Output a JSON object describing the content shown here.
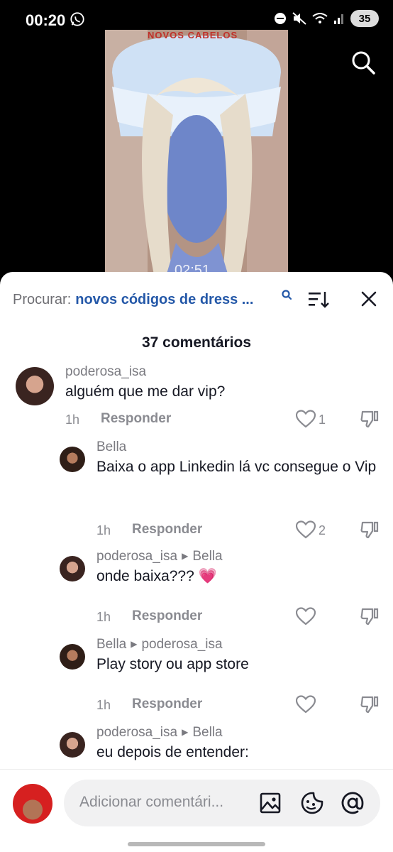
{
  "status": {
    "time": "00:20",
    "battery": "35"
  },
  "video": {
    "banner": "NOVOS CABELOS",
    "timestamp": "02:51"
  },
  "search": {
    "prefix": "Procurar:",
    "query": "novos códigos de dress ..."
  },
  "comments_count": "37 comentários",
  "comments": [
    {
      "user": "poderosa_isa",
      "text": "alguém que me dar vip?",
      "age": "1h",
      "reply": "Responder",
      "likes": "1"
    },
    {
      "user": "Bella",
      "text": "Baixa o app Linkedin lá vc consegue o Vip",
      "age": "1h",
      "reply": "Responder",
      "likes": "2"
    },
    {
      "user": "poderosa_isa",
      "reply_to": "Bella",
      "text": "onde baixa??? 💗",
      "age": "1h",
      "reply": "Responder",
      "likes": ""
    },
    {
      "user": "Bella",
      "reply_to": "poderosa_isa",
      "text": "Play story ou app store",
      "age": "1h",
      "reply": "Responder",
      "likes": ""
    },
    {
      "user": "poderosa_isa",
      "reply_to": "Bella",
      "text": "eu depois de entender:",
      "age": "",
      "reply": "",
      "likes": ""
    }
  ],
  "compose": {
    "placeholder": "Adicionar comentári..."
  },
  "icons": [
    "whatsapp-icon",
    "search-icon",
    "sort-icon",
    "close-icon",
    "heart-icon",
    "dislike-icon",
    "image-icon",
    "emoji-icon",
    "mention-icon"
  ]
}
